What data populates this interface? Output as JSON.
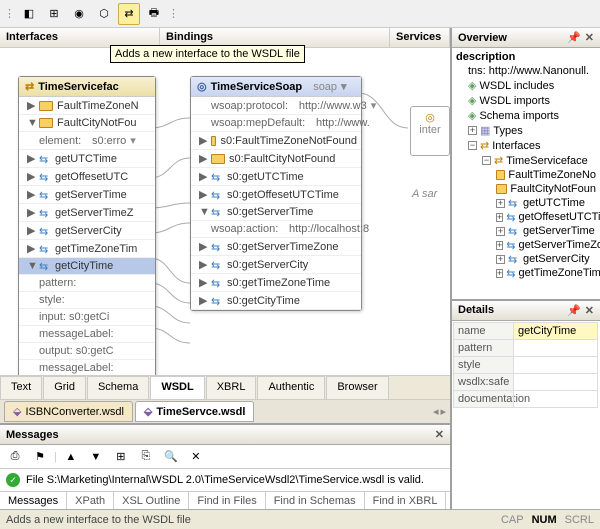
{
  "toolbar": {
    "tooltip": "Adds a new interface to the WSDL file"
  },
  "columns": {
    "interfaces": "Interfaces",
    "bindings": "Bindings",
    "services": "Services"
  },
  "iface_node": {
    "title": "TimeServicefac",
    "rows": [
      "FaultTimeZoneN",
      "FaultCityNotFou"
    ],
    "elem_label": "element:",
    "elem_val": "s0:erro",
    "ops": [
      "getUTCTime",
      "getOffesetUTC",
      "getServerTime",
      "getServerTimeZ",
      "getServerCity",
      "getTimeZoneTim",
      "getCityTime"
    ],
    "pattern": "pattern:",
    "style": "style:",
    "input": "input:  s0:getCi",
    "msglabel": "messageLabel:",
    "output": "output:  s0:getC"
  },
  "bind_node": {
    "title": "TimeServiceSoap",
    "suffix": "soap",
    "proto_l": "wsoap:protocol:",
    "proto_v": "http://www.w3",
    "mep_l": "wsoap:mepDefault:",
    "mep_v": "http://www.",
    "faults": [
      "s0:FaultTimeZoneNotFound",
      "s0:FaultCityNotFound"
    ],
    "ops": [
      "s0:getUTCTime",
      "s0:getOffesetUTCTime",
      "s0:getServerTime"
    ],
    "action_l": "wsoap:action:",
    "action_v": "http://localhost:8",
    "ops2": [
      "s0:getServerTimeZone",
      "s0:getServerCity",
      "s0:getTimeZoneTime",
      "s0:getCityTime"
    ]
  },
  "service_stub": {
    "label": "inter"
  },
  "sample": "A sar",
  "view_tabs": [
    "Text",
    "Grid",
    "Schema",
    "WSDL",
    "XBRL",
    "Authentic",
    "Browser"
  ],
  "file_tabs": [
    "ISBNConverter.wsdl",
    "TimeServce.wsdl"
  ],
  "overview": {
    "title": "Overview",
    "desc": "description",
    "tns": "tns:  http://www.Nanonull.",
    "items": [
      "WSDL includes",
      "WSDL imports",
      "Schema imports",
      "Types",
      "Interfaces"
    ],
    "iface": "TimeServiceface",
    "ops": [
      "FaultTimeZoneNo",
      "FaultCityNotFoun",
      "getUTCTime",
      "getOffesetUTCTim",
      "getServerTime",
      "getServerTimeZo",
      "getServerCity",
      "getTimeZoneTime"
    ]
  },
  "details": {
    "title": "Details",
    "rows": [
      [
        "name",
        "getCityTime"
      ],
      [
        "pattern",
        ""
      ],
      [
        "style",
        ""
      ],
      [
        "wsdlx:safe",
        ""
      ],
      [
        "documentation",
        ""
      ]
    ]
  },
  "messages": {
    "title": "Messages",
    "text": "File S:\\Marketing\\Internal\\WSDL 2.0\\TimeServiceWsdl2\\TimeService.wsdl is valid.",
    "tabs": [
      "Messages",
      "XPath",
      "XSL Outline",
      "Find in Files",
      "Find in Schemas",
      "Find in XBRL"
    ]
  },
  "status": {
    "text": "Adds a new interface to the WSDL file",
    "caps": [
      "CAP",
      "NUM",
      "SCRL"
    ]
  }
}
